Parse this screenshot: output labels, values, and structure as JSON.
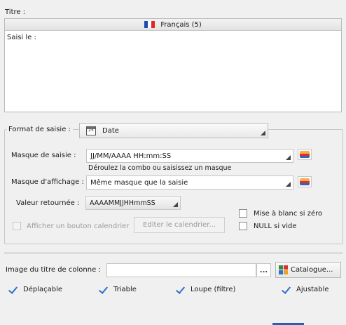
{
  "title_section": {
    "label": "Titre :",
    "language_tab": "Français (5)",
    "flag_colors": [
      "#1f4bb5",
      "#ffffff",
      "#e02626"
    ],
    "editor_text": "Saisi le :"
  },
  "format_group": {
    "legend": "Format de saisie :",
    "format_value": "Date",
    "format_icon": "calendar-icon",
    "masque_saisie_label": "Masque de saisie :",
    "masque_saisie_value": "JJ/MM/AAAA HH:mm:SS",
    "masque_saisie_hint": "Déroulez la combo ou saisissez un masque",
    "masque_affichage_label": "Masque d'affichage :",
    "masque_affichage_value": "Même masque que la saisie",
    "valeur_retournee_label": "Valeur retournée :",
    "valeur_retournee_value": "AAAAMMJJHHmmSS",
    "mise_a_blanc_label": "Mise à blanc si zéro",
    "null_si_vide_label": "NULL si vide",
    "afficher_bouton_label": "Afficher un bouton calendrier",
    "editer_calendrier_label": "Editer le calendrier..."
  },
  "column_image": {
    "label": "Image du titre de colonne :",
    "value": "",
    "browse_label": "...",
    "catalogue_label": "Catalogue..."
  },
  "options": [
    {
      "label": "Déplaçable",
      "checked": true
    },
    {
      "label": "Triable",
      "checked": true
    },
    {
      "label": "Loupe (filtre)",
      "checked": true
    },
    {
      "label": "Ajustable",
      "checked": true
    }
  ],
  "colors": {
    "accent": "#2f6fcf",
    "background": "#f0f0f0"
  }
}
